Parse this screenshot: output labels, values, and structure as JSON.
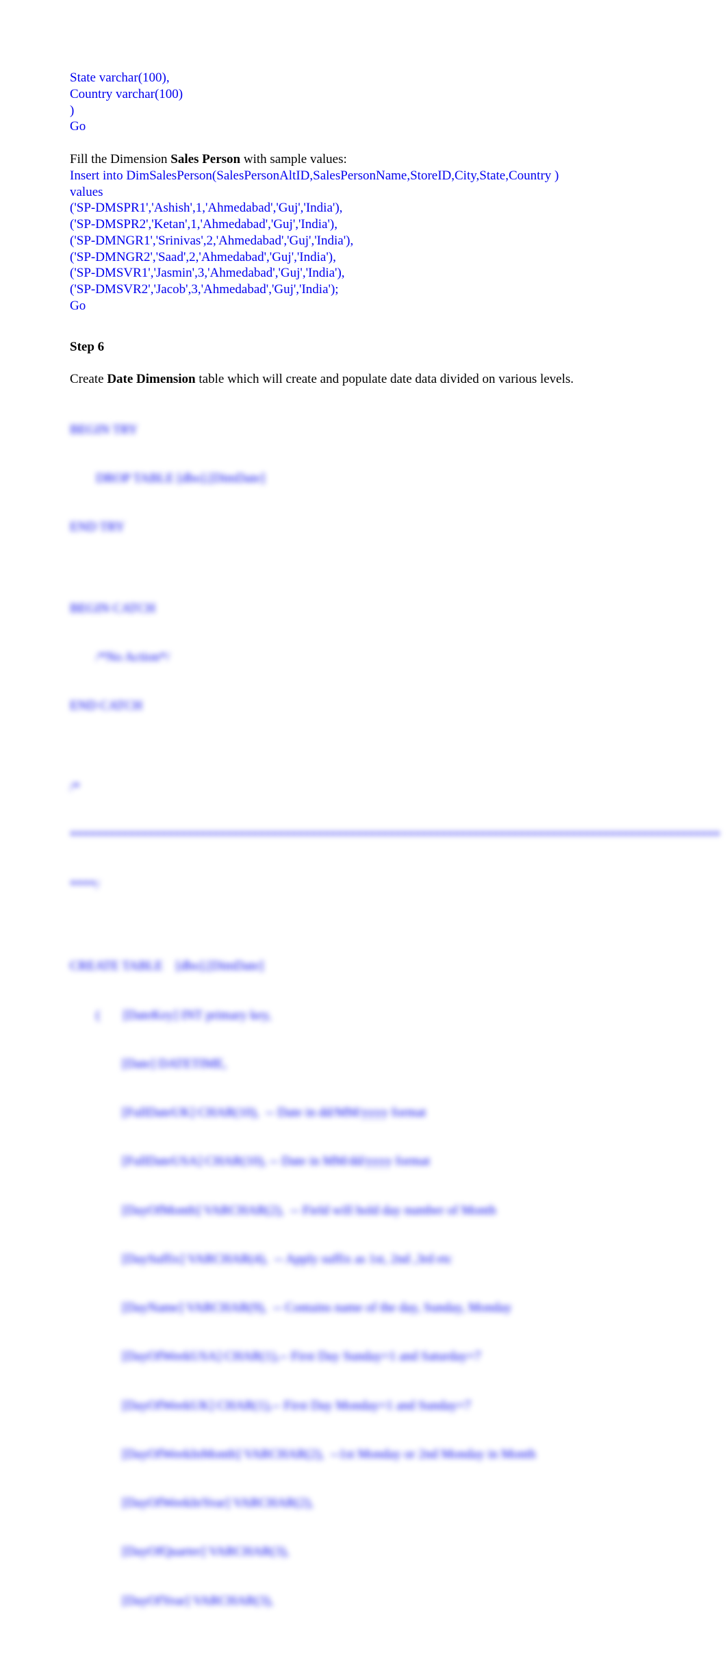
{
  "codeBlock1": [
    "State varchar(100),",
    "Country varchar(100)",
    ")",
    "Go"
  ],
  "fillLine": {
    "prefix": "Fill the Dimension ",
    "bold": "Sales Person",
    "suffix": " with sample values:"
  },
  "codeBlock2": [
    "Insert into DimSalesPerson(SalesPersonAltID,SalesPersonName,StoreID,City,State,Country )",
    "values",
    "('SP-DMSPR1','Ashish',1,'Ahmedabad','Guj','India'),",
    "('SP-DMSPR2','Ketan',1,'Ahmedabad','Guj','India'),",
    "('SP-DMNGR1','Srinivas',2,'Ahmedabad','Guj','India'),",
    "('SP-DMNGR2','Saad',2,'Ahmedabad','Guj','India'),",
    "('SP-DMSVR1','Jasmin',3,'Ahmedabad','Guj','India'),",
    "('SP-DMSVR2','Jacob',3,'Ahmedabad','Guj','India');",
    "Go"
  ],
  "step6": {
    "heading": "Step 6",
    "descPrefix": "Create ",
    "descBold": "Date Dimension",
    "descSuffix": " table which will create and populate date data divided on various levels."
  },
  "blurredBlock": [
    "BEGIN TRY",
    "        DROP TABLE [dbo].[DimDate]",
    "END TRY",
    "",
    "BEGIN CATCH",
    "        /*No Action*/",
    "END CATCH",
    "",
    "/*",
    "****************************************************************************************************",
    "****/",
    "",
    "CREATE TABLE    [dbo].[DimDate]",
    "        (       [DateKey] INT primary key,",
    "                [Date] DATETIME,",
    "                [FullDateUK] CHAR(10),  -- Date in dd/MM/yyyy format",
    "                [FullDateUSA] CHAR(10), -- Date in MM/dd/yyyy format",
    "                [DayOfMonth] VARCHAR(2),  -- Field will hold day number of Month",
    "                [DaySuffix] VARCHAR(4),  -- Apply suffix as 1st, 2nd ,3rd etc",
    "                [DayName] VARCHAR(9),  -- Contains name of the day, Sunday, Monday",
    "                [DayOfWeekUSA] CHAR(1),-- First Day Sunday=1 and Saturday=7",
    "                [DayOfWeekUK] CHAR(1),-- First Day Monday=1 and Sunday=7",
    "                [DayOfWeekInMonth] VARCHAR(2),  --1st Monday or 2nd Monday in Month",
    "                [DayOfWeekInYear] VARCHAR(2),",
    "                [DayOfQuarter] VARCHAR(3),",
    "                [DayOfYear] VARCHAR(3),"
  ]
}
